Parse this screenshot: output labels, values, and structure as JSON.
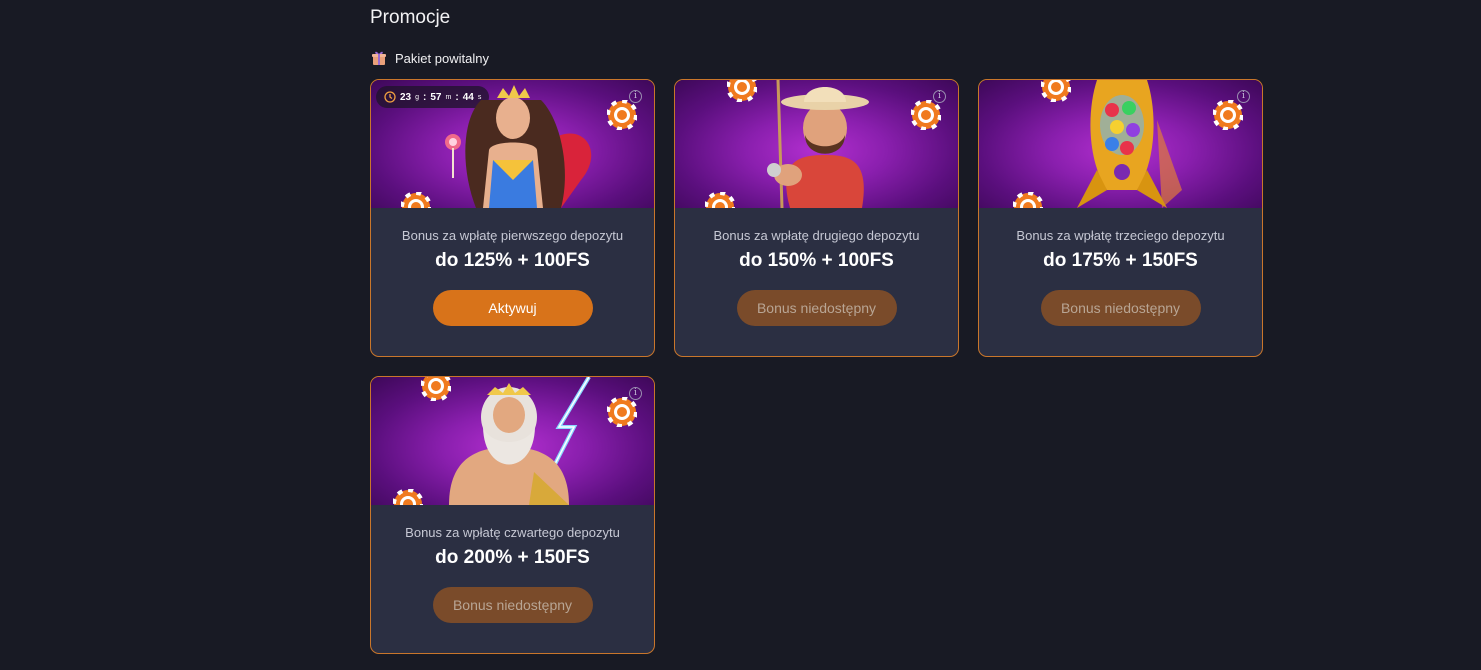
{
  "page": {
    "title": "Promocje"
  },
  "section": {
    "label": "Pakiet powitalny",
    "icon": "gift-icon"
  },
  "timer": {
    "hours": "23",
    "hours_unit": "g",
    "minutes": "57",
    "minutes_unit": "m",
    "seconds": "44",
    "seconds_unit": "s",
    "sep": ":"
  },
  "colors": {
    "background": "#181a24",
    "card": "#2b2f42",
    "border": "#c9762b",
    "accent": "#d8731a",
    "disabled": "#7a4b2a"
  },
  "cards": [
    {
      "subtitle": "Bonus za wpłatę pierwszego depozytu",
      "headline": "do 125% + 100FS",
      "button": "Aktywuj",
      "art": "queen-with-lollipop"
    },
    {
      "subtitle": "Bonus za wpłatę drugiego depozytu",
      "headline": "do 150% + 100FS",
      "button": "Bonus niedostępny",
      "art": "fisherman-cowboy"
    },
    {
      "subtitle": "Bonus za wpłatę trzeciego depozytu",
      "headline": "do 175% + 150FS",
      "button": "Bonus niedostępny",
      "art": "candy-rocket"
    },
    {
      "subtitle": "Bonus za wpłatę czwartego depozytu",
      "headline": "do 200% + 150FS",
      "button": "Bonus niedostępny",
      "art": "zeus-lightning"
    }
  ]
}
